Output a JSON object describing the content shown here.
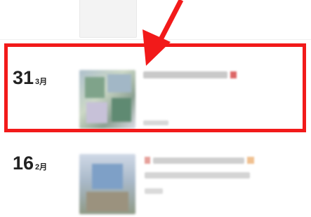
{
  "entries": [
    {
      "day": "",
      "month": "",
      "title": "",
      "subtitle": ""
    },
    {
      "day": "31",
      "month": "3月",
      "title": "",
      "subtitle": ""
    },
    {
      "day": "16",
      "month": "2月",
      "title": "",
      "subtitle": ""
    }
  ],
  "annotation": {
    "highlight_color": "#f21a1a",
    "arrow_color": "#f21a1a"
  },
  "colors": {
    "background": "#ffffff",
    "date_text": "#222222"
  }
}
